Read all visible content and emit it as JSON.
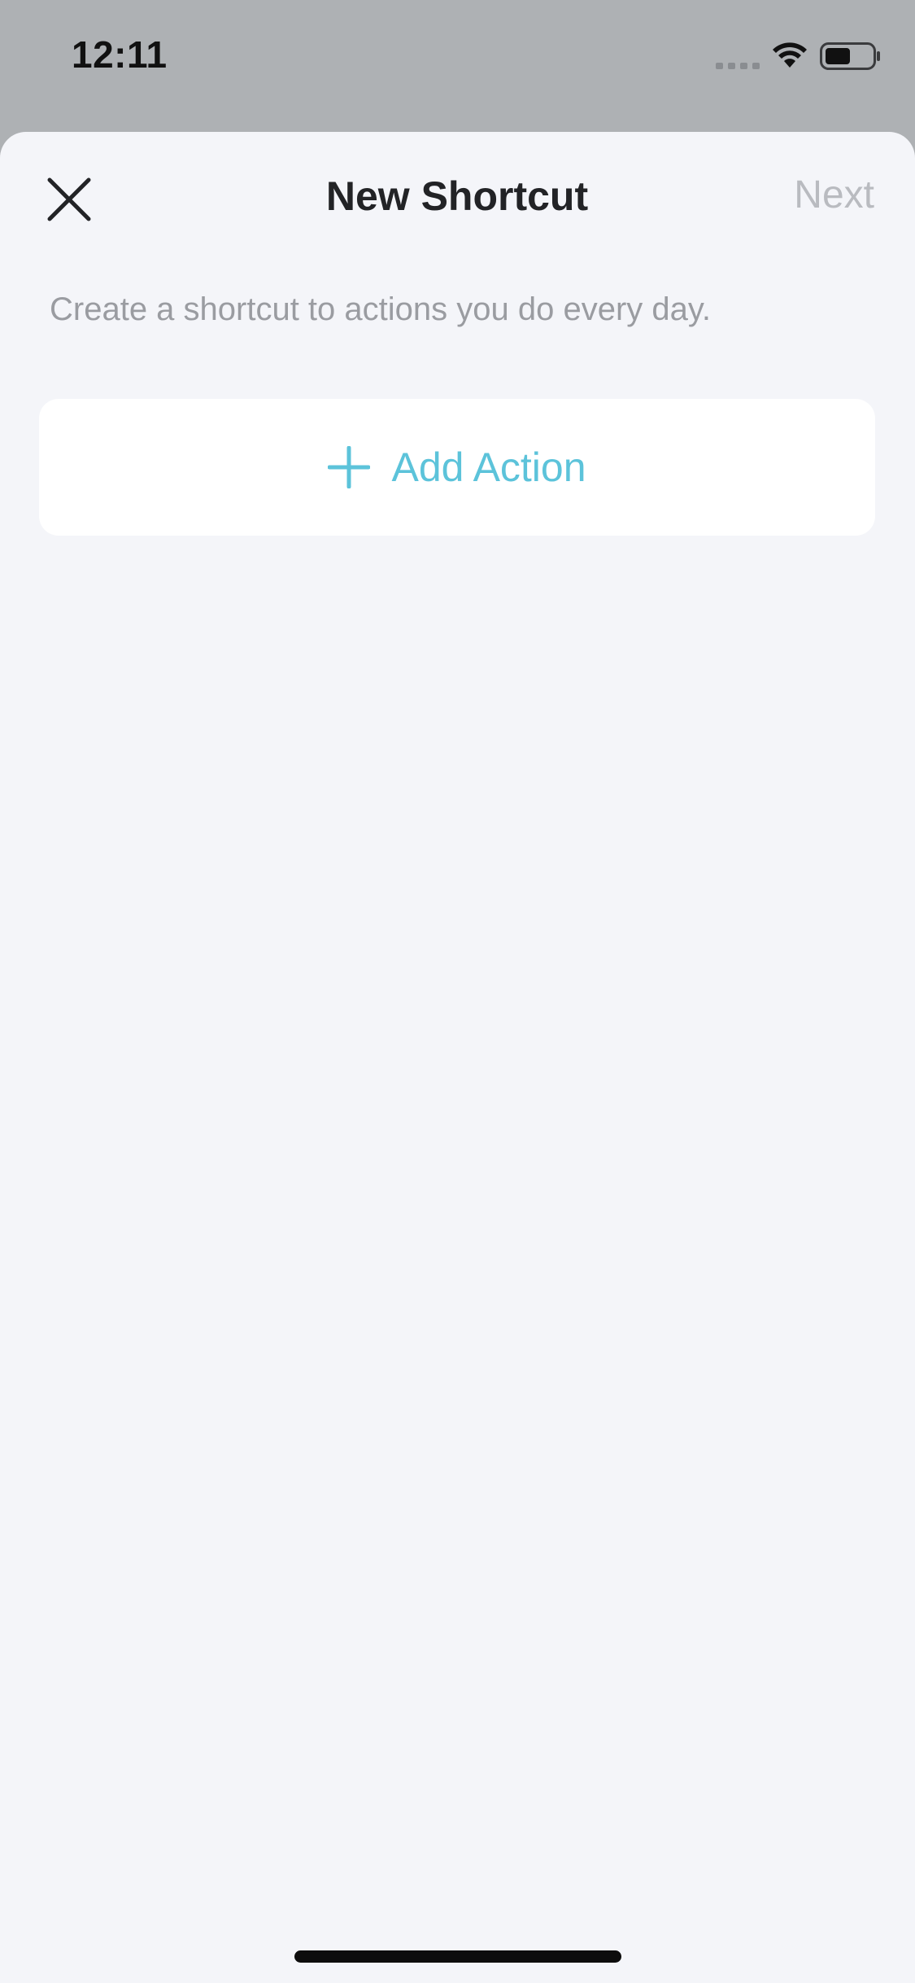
{
  "status_bar": {
    "time": "12:11"
  },
  "header": {
    "title": "New Shortcut",
    "next_label": "Next"
  },
  "main": {
    "subtitle": "Create a shortcut to actions you do every day.",
    "add_action_label": "Add Action"
  },
  "colors": {
    "accent": "#5cc3da",
    "sheet_background": "#f4f5f9",
    "disabled_text": "#b9bbc0"
  },
  "icons": {
    "close": "close-icon",
    "add": "plus-icon",
    "wifi": "wifi-icon",
    "battery": "battery-icon",
    "signal": "signal-icon"
  }
}
